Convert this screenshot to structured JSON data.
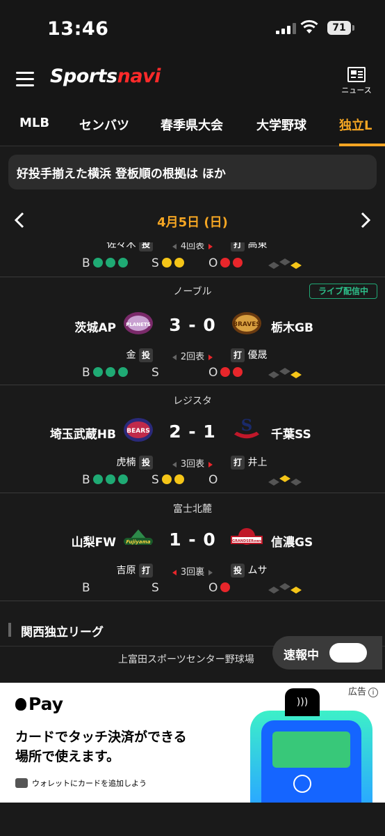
{
  "status_bar": {
    "time": "13:46",
    "battery": "71"
  },
  "header": {
    "logo_part1": "Sports",
    "logo_part2": "navi",
    "news_label": "ニュース"
  },
  "tabs": [
    {
      "label": "MLB"
    },
    {
      "label": "センバツ"
    },
    {
      "label": "春季県大会"
    },
    {
      "label": "大学野球"
    },
    {
      "label": "独立L"
    }
  ],
  "headline": "好投手揃えた横浜 登板順の根拠は ほか",
  "date": "4月5日 (日)",
  "partial_game": {
    "pitcher": "佐々木",
    "pitcher_tag": "投",
    "inning": "4回表",
    "batter_tag": "打",
    "batter": "高東"
  },
  "games": [
    {
      "venue": "ノーブル",
      "live": "ライブ配信中",
      "home": "茨城AP",
      "away": "栃木GB",
      "home_emblem_text": "PLANETS",
      "away_emblem_text": "BRAVES",
      "score": "3 - 0",
      "left_player": "金",
      "left_tag": "投",
      "inning": "2回表",
      "right_tag": "打",
      "right_player": "優晟",
      "balls": 3,
      "strikes": 0,
      "outs": 2
    },
    {
      "venue": "レジスタ",
      "home": "埼玉武蔵HB",
      "away": "千葉SS",
      "home_emblem_text": "BEARS",
      "away_emblem_text": "S",
      "score": "2 - 1",
      "left_player": "虎楠",
      "left_tag": "投",
      "inning": "3回表",
      "right_tag": "打",
      "right_player": "井上",
      "balls": 3,
      "strikes": 2,
      "outs": 0
    },
    {
      "venue": "富士北麓",
      "home": "山梨FW",
      "away": "信濃GS",
      "home_emblem_text": "Fujiyama",
      "away_emblem_text": "GRANDSERows",
      "score": "1 - 0",
      "left_player": "吉原",
      "left_tag": "打",
      "inning": "3回裏",
      "right_tag": "投",
      "right_player": "ムサ",
      "balls": 0,
      "strikes": 0,
      "outs": 1
    }
  ],
  "count_labels": {
    "b": "B",
    "s": "S",
    "o": "O"
  },
  "section_title": "関西独立リーグ",
  "breaking_toggle": "速報中",
  "next_venue": "上富田スポーツセンター野球場",
  "ad": {
    "label": "広告",
    "info": "i",
    "brand": "Pay",
    "line1": "カードでタッチ決済ができる",
    "line2": "場所で使えます。",
    "wallet": "ウォレットにカードを追加しよう"
  }
}
